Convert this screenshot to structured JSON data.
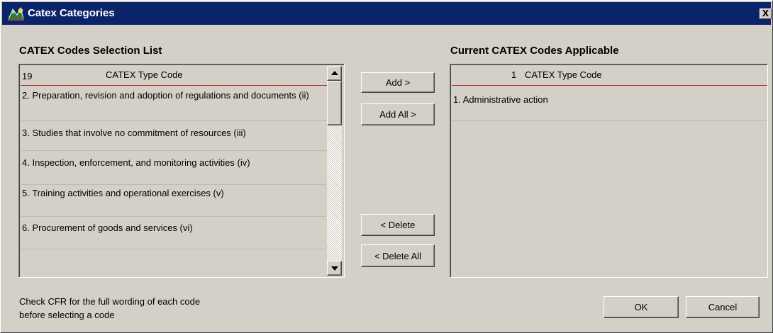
{
  "window": {
    "title": "Catex Categories",
    "close_label": "X"
  },
  "left_panel": {
    "heading": "CATEX Codes Selection List",
    "header_count": "19",
    "header_label": "CATEX Type Code",
    "items": [
      {
        "label": "2. Preparation, revision and adoption of regulations and documents (ii)"
      },
      {
        "label": "3. Studies that involve no commitment of resources (iii)"
      },
      {
        "label": "4. Inspection, enforcement, and monitoring activities (iv)"
      },
      {
        "label": "5. Training activities and operational exercises (v)"
      },
      {
        "label": "6. Procurement of goods and services (vi)"
      }
    ]
  },
  "right_panel": {
    "heading": "Current CATEX Codes Applicable",
    "header_count": "1",
    "header_label": "CATEX Type Code",
    "items": [
      {
        "label": "1. Administrative action"
      }
    ]
  },
  "buttons": {
    "add": "Add >",
    "add_all": "Add All >",
    "delete": "< Delete",
    "delete_all": "< Delete All",
    "ok": "OK",
    "cancel": "Cancel"
  },
  "footer_note": {
    "line1": "Check CFR for the full wording of each code",
    "line2": "before selecting a code"
  },
  "colors": {
    "titlebar": "#0a246a",
    "header_divider": "#a52a2a",
    "dialog_bg": "#d4d0c8"
  }
}
